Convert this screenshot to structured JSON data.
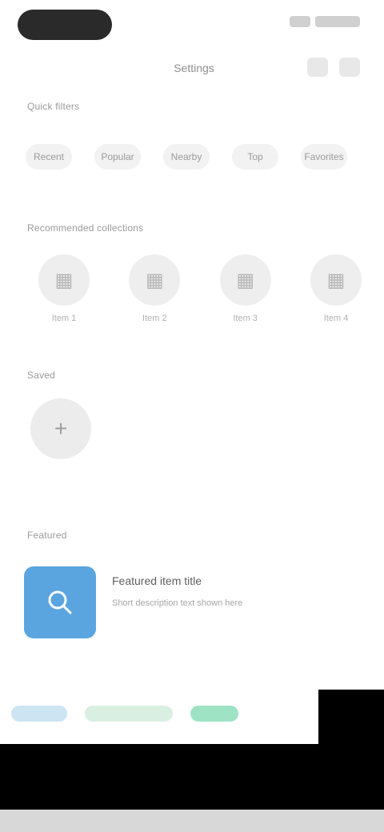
{
  "header": {
    "title": "Settings",
    "actions": [
      "search-icon",
      "more-icon"
    ]
  },
  "sections": {
    "first_heading": "Quick filters",
    "second_heading": "Recommended collections",
    "third_heading": "Saved",
    "fourth_heading": "Featured"
  },
  "filters": [
    "Recent",
    "Popular",
    "Nearby",
    "Top",
    "Favorites"
  ],
  "round_items": [
    {
      "label": "Item 1",
      "icon": "grid-icon"
    },
    {
      "label": "Item 2",
      "icon": "grid-icon"
    },
    {
      "label": "Item 3",
      "icon": "grid-icon"
    },
    {
      "label": "Item 4",
      "icon": "grid-icon"
    }
  ],
  "single_item": {
    "label": "",
    "icon": "plus-icon"
  },
  "card": {
    "title": "Featured item title",
    "subtitle": "Short description text shown here",
    "icon": "search-icon",
    "accent": "#5aa5e0"
  },
  "nav": {
    "segments": [
      {
        "name": "nav-item-1",
        "color": "#cde4f3"
      },
      {
        "name": "nav-item-2",
        "color": "#d9efe2"
      },
      {
        "name": "nav-item-3",
        "color": "#9fe3c5"
      }
    ]
  },
  "colors": {
    "background": "#ffffff",
    "status_pill": "#2a2a2a",
    "card_accent": "#5aa5e0",
    "bottom_band": "#000000"
  }
}
